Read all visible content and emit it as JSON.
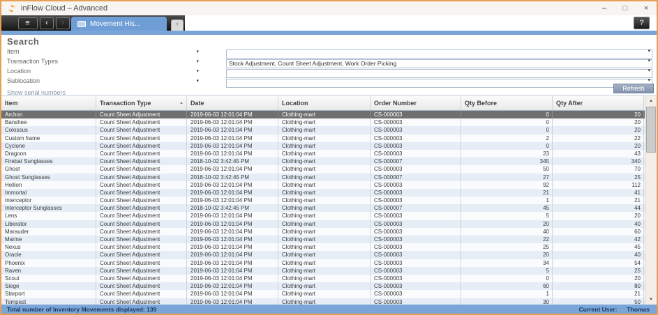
{
  "window": {
    "title": "inFlow Cloud – Advanced",
    "controls": {
      "minimize": "–",
      "maximize": "□",
      "close": "×"
    }
  },
  "icons": {
    "hamburger": "≡",
    "back": "‹",
    "forward": "›",
    "new_tab": "+",
    "help": "?",
    "dropdown": "▾",
    "sort_ascending": "▲",
    "scroll_up": "▲",
    "scroll_down": "▼"
  },
  "tabs": {
    "active": "Movement His..."
  },
  "search": {
    "title": "Search",
    "fields": [
      {
        "label": "Item",
        "value": ""
      },
      {
        "label": "Transaction Types",
        "value": "Stock Adjustment, Count Sheet Adjustment, Work Order Picking"
      },
      {
        "label": "Location",
        "value": ""
      },
      {
        "label": "Sublocation",
        "value": ""
      }
    ],
    "show_serial_link": "Show serial numbers",
    "refresh_label": "Refresh"
  },
  "table": {
    "columns": [
      "Item",
      "Transaction Type",
      "Date",
      "Location",
      "Order Number",
      "Qty Before",
      "Qty After"
    ],
    "sorted_column": "Transaction Type",
    "sort_direction": "ascending",
    "selected_row_index": 0,
    "rows": [
      [
        "Archon",
        "Count Sheet Adjustment",
        "2019-06-03 12:01:04 PM",
        "Clothing-mart",
        "CS-000003",
        "0",
        "20"
      ],
      [
        "Banshee",
        "Count Sheet Adjustment",
        "2019-06-03 12:01:04 PM",
        "Clothing-mart",
        "CS-000003",
        "0",
        "20"
      ],
      [
        "Colossus",
        "Count Sheet Adjustment",
        "2019-06-03 12:01:04 PM",
        "Clothing-mart",
        "CS-000003",
        "0",
        "20"
      ],
      [
        "Custom frame",
        "Count Sheet Adjustment",
        "2019-06-03 12:01:04 PM",
        "Clothing-mart",
        "CS-000003",
        "2",
        "22"
      ],
      [
        "Cyclone",
        "Count Sheet Adjustment",
        "2019-06-03 12:01:04 PM",
        "Clothing-mart",
        "CS-000003",
        "0",
        "20"
      ],
      [
        "Dragoon",
        "Count Sheet Adjustment",
        "2019-06-03 12:01:04 PM",
        "Clothing-mart",
        "CS-000003",
        "23",
        "43"
      ],
      [
        "Firebat Sunglasses",
        "Count Sheet Adjustment",
        "2018-10-02 3:42:45 PM",
        "Clothing-mart",
        "CS-000007",
        "345",
        "340"
      ],
      [
        "Ghost",
        "Count Sheet Adjustment",
        "2019-06-03 12:01:04 PM",
        "Clothing-mart",
        "CS-000003",
        "50",
        "70"
      ],
      [
        "Ghost Sunglasses",
        "Count Sheet Adjustment",
        "2018-10-02 3:42:45 PM",
        "Clothing-mart",
        "CS-000007",
        "27",
        "25"
      ],
      [
        "Hellion",
        "Count Sheet Adjustment",
        "2019-06-03 12:01:04 PM",
        "Clothing-mart",
        "CS-000003",
        "92",
        "112"
      ],
      [
        "Immortal",
        "Count Sheet Adjustment",
        "2019-06-03 12:01:04 PM",
        "Clothing-mart",
        "CS-000003",
        "21",
        "41"
      ],
      [
        "Interceptor",
        "Count Sheet Adjustment",
        "2019-06-03 12:01:04 PM",
        "Clothing-mart",
        "CS-000003",
        "1",
        "21"
      ],
      [
        "Interceptor Sunglasses",
        "Count Sheet Adjustment",
        "2018-10-02 3:42:45 PM",
        "Clothing-mart",
        "CS-000007",
        "45",
        "44"
      ],
      [
        "Lens",
        "Count Sheet Adjustment",
        "2019-06-03 12:01:04 PM",
        "Clothing-mart",
        "CS-000003",
        "5",
        "20"
      ],
      [
        "Liberator",
        "Count Sheet Adjustment",
        "2019-06-03 12:01:04 PM",
        "Clothing-mart",
        "CS-000003",
        "20",
        "40"
      ],
      [
        "Marauder",
        "Count Sheet Adjustment",
        "2019-06-03 12:01:04 PM",
        "Clothing-mart",
        "CS-000003",
        "40",
        "60"
      ],
      [
        "Marine",
        "Count Sheet Adjustment",
        "2019-06-03 12:01:04 PM",
        "Clothing-mart",
        "CS-000003",
        "22",
        "42"
      ],
      [
        "Nexus",
        "Count Sheet Adjustment",
        "2019-06-03 12:01:04 PM",
        "Clothing-mart",
        "CS-000003",
        "25",
        "45"
      ],
      [
        "Oracle",
        "Count Sheet Adjustment",
        "2019-06-03 12:01:04 PM",
        "Clothing-mart",
        "CS-000003",
        "20",
        "40"
      ],
      [
        "Phoenix",
        "Count Sheet Adjustment",
        "2019-06-03 12:01:04 PM",
        "Clothing-mart",
        "CS-000003",
        "34",
        "54"
      ],
      [
        "Raven",
        "Count Sheet Adjustment",
        "2019-06-03 12:01:04 PM",
        "Clothing-mart",
        "CS-000003",
        "5",
        "25"
      ],
      [
        "Scout",
        "Count Sheet Adjustment",
        "2019-06-03 12:01:04 PM",
        "Clothing-mart",
        "CS-000003",
        "0",
        "20"
      ],
      [
        "Siege",
        "Count Sheet Adjustment",
        "2019-06-03 12:01:04 PM",
        "Clothing-mart",
        "CS-000003",
        "60",
        "80"
      ],
      [
        "Starport",
        "Count Sheet Adjustment",
        "2019-06-03 12:01:04 PM",
        "Clothing-mart",
        "CS-000003",
        "1",
        "21"
      ],
      [
        "Tempest",
        "Count Sheet Adjustment",
        "2019-06-03 12:01:04 PM",
        "Clothing-mart",
        "CS-000003",
        "30",
        "50"
      ]
    ]
  },
  "statusbar": {
    "left": "Total number of Inventory Movements displayed: 139",
    "right_label": "Current User:",
    "right_value": "Thomas"
  },
  "colors": {
    "window_border": "#e99e53",
    "accent_blue": "#7aa5d8",
    "tab_blue": "#6f9ed6",
    "selected_row": "#6f6f6f",
    "row_alt_blue": "#e6edf6",
    "status_text": "#17375e"
  }
}
